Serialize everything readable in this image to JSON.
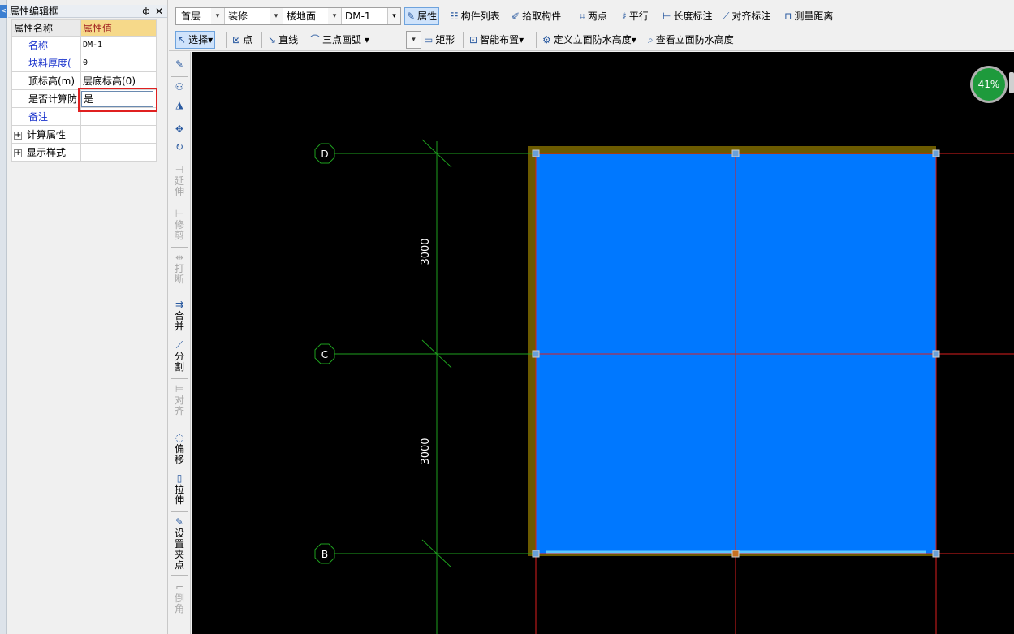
{
  "property_panel": {
    "tab_glyph": "<",
    "title": "属性编辑框",
    "pin_glyph": "ф",
    "close_glyph": "✕",
    "header": {
      "name_col": "属性名称",
      "value_col": "属性值"
    },
    "rows": [
      {
        "name": "名称",
        "value": "DM-1"
      },
      {
        "name": "块料厚度(",
        "value": "0"
      },
      {
        "name": "顶标高(m)",
        "value": "层底标高(0)"
      },
      {
        "name": "是否计算防",
        "value": "是"
      },
      {
        "name": "备注",
        "value": ""
      }
    ],
    "groups": [
      {
        "expand": "+",
        "name": "计算属性"
      },
      {
        "expand": "+",
        "name": "显示样式"
      }
    ]
  },
  "toolbar1": {
    "floor": "首层",
    "category": "装修",
    "component_type": "楼地面",
    "component": "DM-1",
    "attribute_btn": "属性",
    "component_list_btn": "构件列表",
    "pick_btn": "拾取构件",
    "two_points_btn": "两点",
    "parallel_btn": "平行",
    "length_dim_btn": "长度标注",
    "align_dim_btn": "对齐标注",
    "measure_btn": "测量距离"
  },
  "toolbar2": {
    "select_btn": "选择",
    "point_btn": "点",
    "line_btn": "直线",
    "arc_mode": "三点画弧",
    "rect_btn": "矩形",
    "smart_layout_btn": "智能布置",
    "define_height_btn": "定义立面防水高度",
    "view_height_btn": "查看立面防水高度"
  },
  "vtoolbar": [
    {
      "label": "延伸",
      "enabled": false
    },
    {
      "label": "修剪",
      "enabled": false
    },
    {
      "label": "打断",
      "enabled": false
    },
    {
      "label": "合并",
      "enabled": true
    },
    {
      "label": "分割",
      "enabled": true
    },
    {
      "label": "对齐",
      "enabled": false
    },
    {
      "label": "偏移",
      "enabled": true
    },
    {
      "label": "拉伸",
      "enabled": true
    },
    {
      "label": "设置夹点",
      "enabled": true
    },
    {
      "label": "倒角",
      "enabled": false
    }
  ],
  "canvas": {
    "axes": [
      {
        "label": "D"
      },
      {
        "label": "C"
      },
      {
        "label": "B"
      }
    ],
    "dimensions": [
      "3000",
      "3000"
    ],
    "colors": {
      "background": "#000000",
      "floor_fill": "#0078ff",
      "border": "#6b5a00",
      "axis_line": "#1ea01e",
      "grid_line": "#dc1e1e",
      "grip": "#6aa0d8"
    },
    "progress": "41%"
  }
}
